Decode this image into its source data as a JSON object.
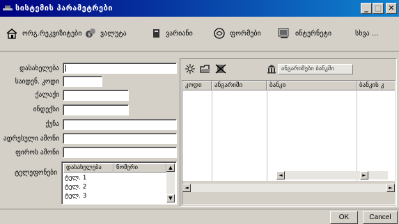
{
  "window": {
    "title": "სისტემის პარამეტრები",
    "minimize": "_",
    "maximize": "□",
    "close": "✕"
  },
  "toolbar": {
    "items": [
      {
        "label": "ორგ.რეკვიზიტები",
        "icon": "home-icon"
      },
      {
        "label": "ვალუტა",
        "icon": "currency-icon"
      },
      {
        "label": "ვარიანი",
        "icon": "book-icon"
      },
      {
        "label": "ფორმები",
        "icon": "forms-icon"
      },
      {
        "label": "ინტერნეტი",
        "icon": "internet-icon"
      },
      {
        "label": "სხვა ..."
      }
    ]
  },
  "form": {
    "name": {
      "label": "დასახელება",
      "value": ""
    },
    "tax_code": {
      "label": "საიდენ. კოდი",
      "value": ""
    },
    "city": {
      "label": "ქალაქი",
      "value": ""
    },
    "index": {
      "label": "ინდექსი",
      "value": ""
    },
    "street": {
      "label": "ქუჩა",
      "value": ""
    },
    "legal_address": {
      "label": "ადრესული ამონი",
      "value": ""
    },
    "fact_address": {
      "label": "ფიროს ამონი",
      "value": ""
    },
    "phones": {
      "label": "ტელეფონები",
      "columns": [
        "დასახელება",
        "ნომერი"
      ],
      "rows": [
        "ტელ. 1",
        "ტელ. 2",
        "ტელ. 3"
      ]
    }
  },
  "banks": {
    "field_label": "ანგარიშები ბანკში",
    "columns": [
      "კოდი",
      "ანგარიში",
      "ბანკი",
      "ბანკის კ"
    ]
  },
  "buttons": {
    "ok": "OK",
    "cancel": "Cancel"
  }
}
